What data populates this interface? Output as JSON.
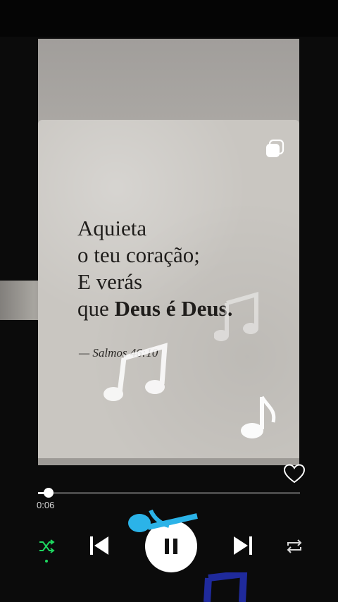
{
  "post": {
    "quote_lines": [
      "Aquieta",
      "o teu coração;",
      "E verás"
    ],
    "quote_last_prefix": "que ",
    "quote_last_bold": "Deus é Deus.",
    "reference": "— Salmos 46:10"
  },
  "player": {
    "elapsed": "0:06",
    "progress_fraction": 0.04,
    "liked": false,
    "shuffle_active": true
  },
  "colors": {
    "accent_green": "#1ed760",
    "background": "#0b0b0b",
    "sticker_blue": "#2bb3e8",
    "sticker_navy": "#1f2a9c"
  },
  "icons": [
    "copy-icon",
    "music-note-icon",
    "heart-icon",
    "shuffle-icon",
    "previous-icon",
    "pause-icon",
    "next-icon",
    "repeat-icon"
  ]
}
